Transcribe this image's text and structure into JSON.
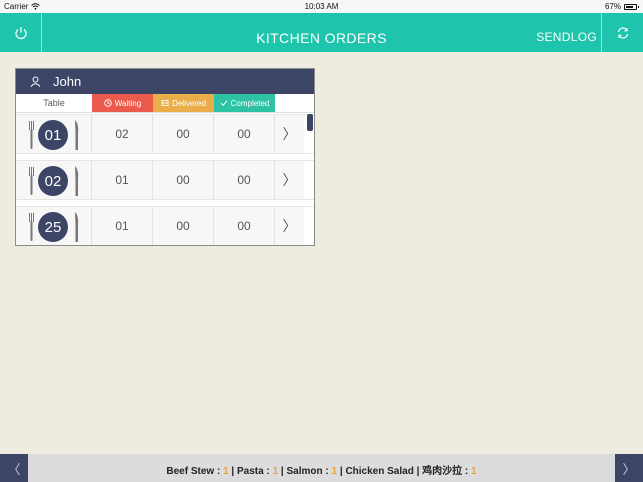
{
  "statusbar": {
    "carrier": "Carrier",
    "time": "10:03 AM",
    "battery": "67%"
  },
  "header": {
    "title": "KITCHEN ORDERS",
    "sendlog": "SENDLOG"
  },
  "panel": {
    "user": "John",
    "columns": {
      "table": "Table",
      "waiting": "Waiting",
      "delivered": "Delivered",
      "completed": "Completed"
    },
    "rows": [
      {
        "table": "01",
        "waiting": "02",
        "delivered": "00",
        "completed": "00",
        "arrow": "〉"
      },
      {
        "table": "02",
        "waiting": "01",
        "delivered": "00",
        "completed": "00",
        "arrow": "〉"
      },
      {
        "table": "25",
        "waiting": "01",
        "delivered": "00",
        "completed": "00",
        "arrow": "〉"
      }
    ]
  },
  "footer": {
    "prev": "〈",
    "next": "〉",
    "items": [
      {
        "name": "Beef Stew",
        "qty": "1"
      },
      {
        "name": "Pasta",
        "qty": "1"
      },
      {
        "name": "Salmon",
        "qty": "1"
      },
      {
        "name": "Chicken Salad",
        "qty": null
      },
      {
        "name": "鸡肉沙拉",
        "qty": "1"
      }
    ]
  },
  "colors": {
    "teal": "#1ec4ac",
    "navy": "#3d4567",
    "waiting": "#eb5a4c",
    "delivered": "#e9ae49",
    "completed": "#2ec2a5"
  }
}
